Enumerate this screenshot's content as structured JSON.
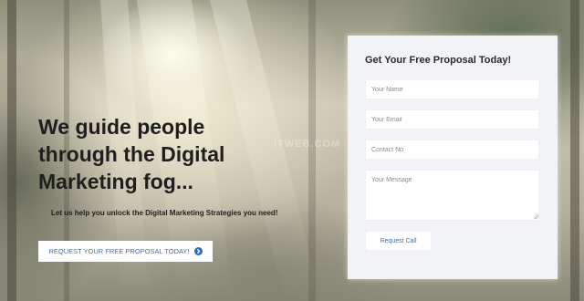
{
  "hero": {
    "heading_line1": "We guide people",
    "heading_line2": "through the Digital",
    "heading_line3": "Marketing fog...",
    "subheading": "Let us help you unlock the Digital Marketing Strategies you need!",
    "cta_label": "REQUEST YOUR FREE PROPOSAL TODAY!",
    "cta_icon": "arrow-right-circle-icon"
  },
  "form": {
    "title": "Get Your Free Proposal Today!",
    "name_placeholder": "Your Name",
    "email_placeholder": "Your Email",
    "contact_placeholder": "Contact No",
    "message_placeholder": "Your Message",
    "submit_label": "Request Call"
  },
  "watermark": "ITWEB.COM",
  "colors": {
    "accent": "#2d6bc0",
    "link_text": "#3d6fb0",
    "card_bg": "#f1f3f6",
    "heading_text": "#1e1e1e"
  }
}
